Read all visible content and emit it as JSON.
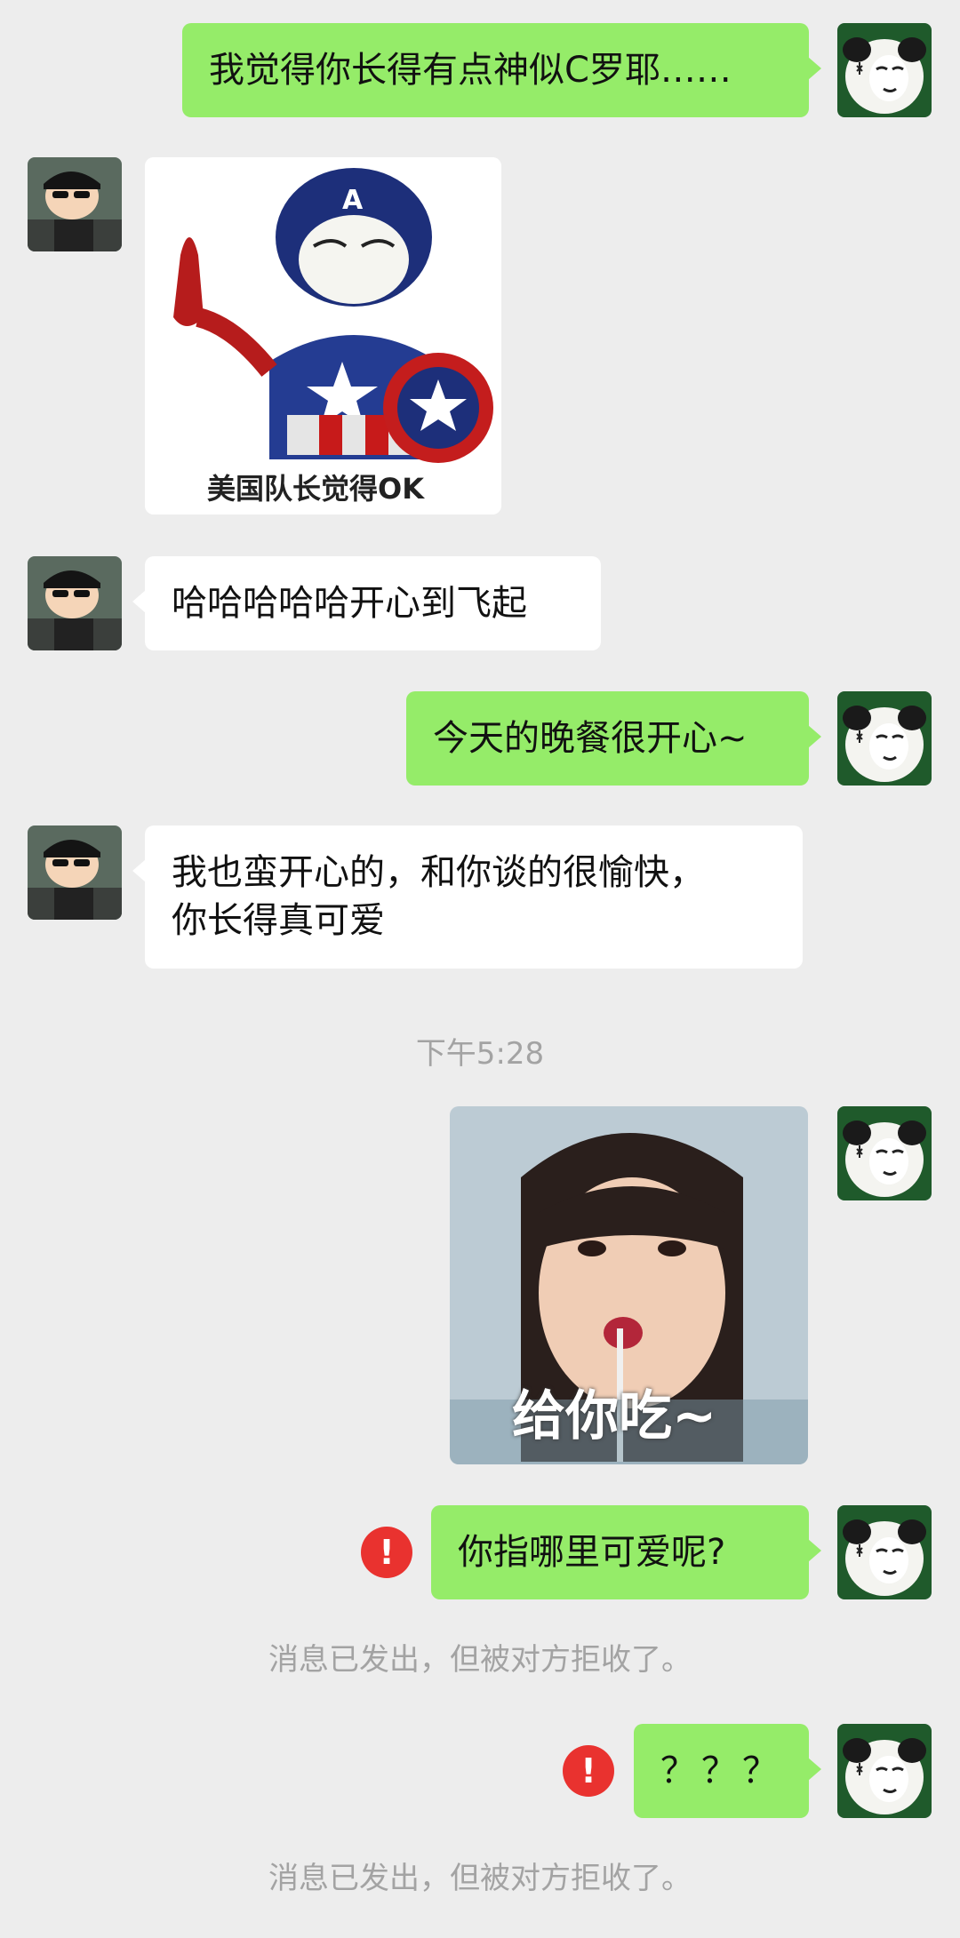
{
  "messages": {
    "m1": "我觉得你长得有点神似C罗耶……",
    "m2_caption": "美国队长觉得OK",
    "m3": "哈哈哈哈哈开心到飞起",
    "m4": "今天的晚餐很开心~",
    "m5_line1": "我也蛮开心的，和你谈的很愉快，",
    "m5_line2": "你长得真可爱",
    "timestamp": "下午5:28",
    "m6_caption": "给你吃~",
    "m7": "你指哪里可爱呢?",
    "rejected_1": "消息已发出，但被对方拒收了。",
    "m8": "？？？",
    "rejected_2": "消息已发出，但被对方拒收了。"
  },
  "icons": {
    "error": "!",
    "my_avatar": "panda-meme-avatar",
    "their_avatar": "cartoon-boy-sunglasses-avatar"
  },
  "colors": {
    "background": "#ededed",
    "my_bubble": "#95ec69",
    "their_bubble": "#ffffff",
    "error_badge": "#e9322f",
    "system_text": "#a3a3a3"
  }
}
